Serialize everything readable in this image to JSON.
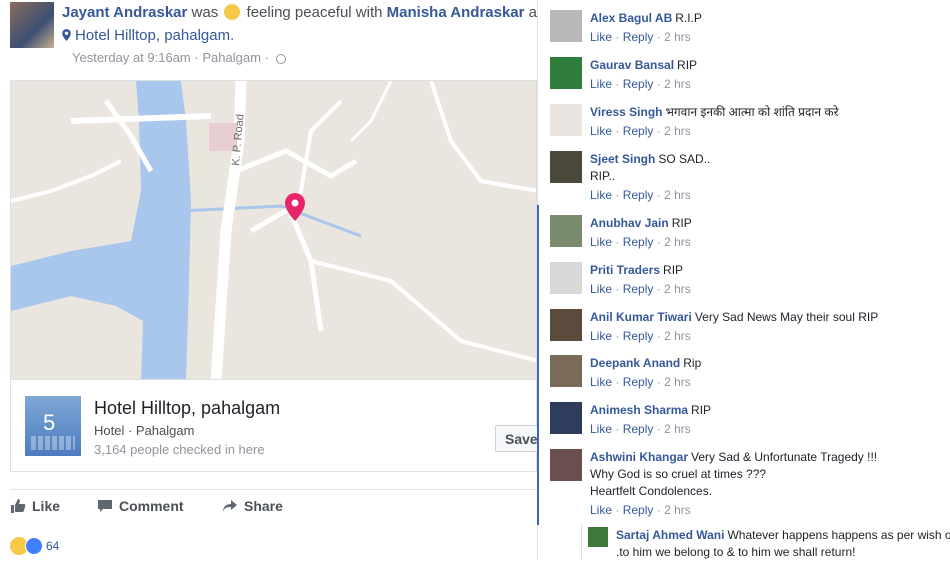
{
  "post": {
    "author": "Jayant Andraskar",
    "was_text": "was",
    "feeling_text": "feeling peaceful with",
    "with_name": "Manisha Andraskar",
    "at_text": "at",
    "location": "Hotel Hilltop, pahalgam.",
    "timestamp": "Yesterday at 9:16am",
    "sep1": "·",
    "place_short": "Pahalgam",
    "sep2": "·",
    "globe_icon": "globe-icon"
  },
  "map": {
    "road_label": "K. P. Road",
    "water_color": "#a9c6ec",
    "land_color": "#eae6df",
    "road_color": "#ffffff",
    "pin_color": "#e8256a"
  },
  "place": {
    "thumb_digit": "5",
    "title": "Hotel Hilltop, pahalgam",
    "category": "Hotel · Pahalgam",
    "checkins": "3,164 people checked in here",
    "save_label": "Save"
  },
  "actions": {
    "like": "Like",
    "comment": "Comment",
    "share": "Share"
  },
  "reactions": {
    "count": "64"
  },
  "comment_meta": {
    "like": "Like",
    "dot": "·",
    "reply": "Reply",
    "dot2": "·"
  },
  "comments": [
    {
      "name": "Alex Bagul AB",
      "text": "R.I.P",
      "lines": [],
      "time": "2 hrs",
      "avatar": "#b8b8b8"
    },
    {
      "name": "Gaurav Bansal",
      "text": "RIP",
      "lines": [],
      "time": "2 hrs",
      "avatar": "#2f7d3a"
    },
    {
      "name": "Viress Singh",
      "text": "भगवान इनकी आत्मा को शांति प्रदान करे",
      "lines": [],
      "time": "2 hrs",
      "avatar": "#e9e4e0"
    },
    {
      "name": "Sjeet Singh",
      "text": "SO SAD..",
      "lines": [
        "RIP.."
      ],
      "time": "2 hrs",
      "avatar": "#4b4a3a"
    },
    {
      "name": "Anubhav Jain",
      "text": "RIP",
      "lines": [],
      "time": "2 hrs",
      "avatar": "#7a8a6c"
    },
    {
      "name": "Priti Traders",
      "text": "RIP",
      "lines": [],
      "time": "2 hrs",
      "avatar": "#d8d8d8"
    },
    {
      "name": "Anil Kumar Tiwari",
      "text": "Very Sad News May their soul RIP",
      "lines": [],
      "time": "2 hrs",
      "avatar": "#5a4b3c"
    },
    {
      "name": "Deepank Anand",
      "text": "Rip",
      "lines": [],
      "time": "2 hrs",
      "avatar": "#7a6a58"
    },
    {
      "name": "Animesh Sharma",
      "text": "RIP",
      "lines": [],
      "time": "2 hrs",
      "avatar": "#2e3d5c"
    },
    {
      "name": "Ashwini Khangar",
      "text": "Very Sad & Unfortunate Tragedy !!!",
      "lines": [
        "Why God is so cruel at times ???",
        "Heartfelt Condolences."
      ],
      "time": "2 hrs",
      "avatar": "#6b4e4e"
    }
  ],
  "reply": {
    "name": "Sartaj Ahmed Wani",
    "text": "Whatever happens happens as per wish of",
    "line2": ".to him we belong to & to him we shall return!",
    "avatar": "#3f7a3a"
  }
}
